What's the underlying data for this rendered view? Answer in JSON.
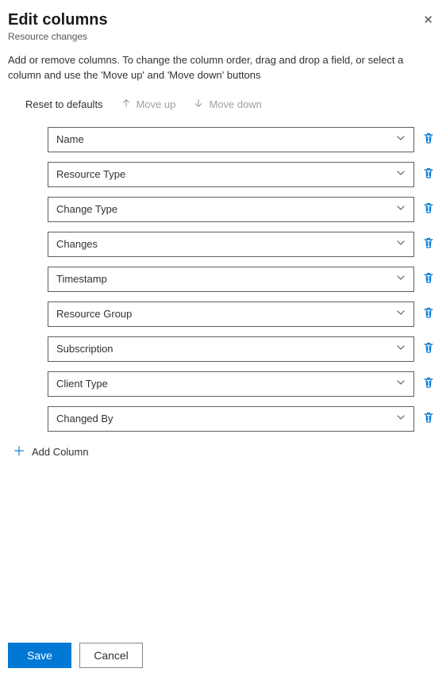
{
  "header": {
    "title": "Edit columns",
    "subtitle": "Resource changes"
  },
  "description": "Add or remove columns. To change the column order, drag and drop a field, or select a column and use the 'Move up' and 'Move down' buttons",
  "toolbar": {
    "reset": "Reset to defaults",
    "move_up": "Move up",
    "move_down": "Move down"
  },
  "columns": [
    {
      "label": "Name"
    },
    {
      "label": "Resource Type"
    },
    {
      "label": "Change Type"
    },
    {
      "label": "Changes"
    },
    {
      "label": "Timestamp"
    },
    {
      "label": "Resource Group"
    },
    {
      "label": "Subscription"
    },
    {
      "label": "Client Type"
    },
    {
      "label": "Changed By"
    }
  ],
  "add_column_label": "Add Column",
  "footer": {
    "save": "Save",
    "cancel": "Cancel"
  }
}
